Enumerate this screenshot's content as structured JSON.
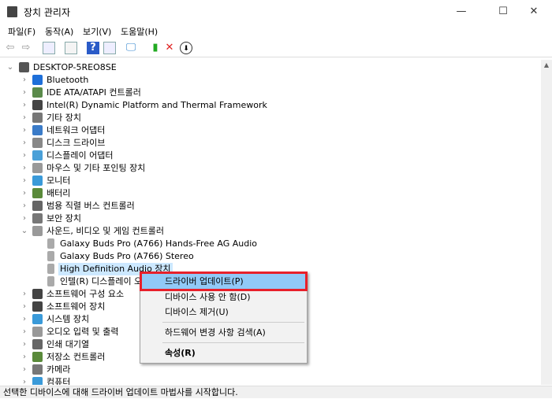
{
  "window": {
    "title": "장치 관리자",
    "minimize": "—",
    "maximize": "☐",
    "close": "✕"
  },
  "menu": [
    "파일(F)",
    "동작(A)",
    "보기(V)",
    "도움말(H)"
  ],
  "toolbar": [
    "back-icon",
    "forward-icon",
    "show-hide-console-tree-icon",
    "properties-icon",
    "help-icon",
    "action-pane-icon",
    "scan-hardware-icon",
    "update-driver-icon",
    "uninstall-icon",
    "disable-icon"
  ],
  "tree": {
    "root": "DESKTOP-5REO8SE",
    "items": [
      {
        "label": "Bluetooth",
        "color": "#1e6fd9"
      },
      {
        "label": "IDE ATA/ATAPI 컨트롤러",
        "color": "#5a8a4a"
      },
      {
        "label": "Intel(R) Dynamic Platform and Thermal Framework",
        "color": "#444"
      },
      {
        "label": "기타 장치",
        "color": "#777"
      },
      {
        "label": "네트워크 어댑터",
        "color": "#3a7bc8"
      },
      {
        "label": "디스크 드라이브",
        "color": "#888"
      },
      {
        "label": "디스플레이 어댑터",
        "color": "#4aa0d8"
      },
      {
        "label": "마우스 및 기타 포인팅 장치",
        "color": "#999"
      },
      {
        "label": "모니터",
        "color": "#3a9ad9"
      },
      {
        "label": "배터리",
        "color": "#5a8a3a"
      },
      {
        "label": "범용 직렬 버스 컨트롤러",
        "color": "#666"
      },
      {
        "label": "보안 장치",
        "color": "#777"
      },
      {
        "label": "사운드, 비디오 및 게임 컨트롤러",
        "color": "#999",
        "expanded": true,
        "children": [
          "Galaxy Buds Pro (A766) Hands-Free AG Audio",
          "Galaxy Buds Pro (A766) Stereo",
          "High Definition Audio 장치",
          "인텔(R) 디스플레이 오디오"
        ]
      },
      {
        "label": "소프트웨어 구성 요소",
        "color": "#444"
      },
      {
        "label": "소프트웨어 장치",
        "color": "#444"
      },
      {
        "label": "시스템 장치",
        "color": "#3a9ad9"
      },
      {
        "label": "오디오 입력 및 출력",
        "color": "#999"
      },
      {
        "label": "인쇄 대기열",
        "color": "#666"
      },
      {
        "label": "저장소 컨트롤러",
        "color": "#5a8a3a"
      },
      {
        "label": "카메라",
        "color": "#777"
      },
      {
        "label": "컴퓨터",
        "color": "#3a9ad9"
      }
    ]
  },
  "context_menu": {
    "items": [
      "드라이버 업데이트(P)",
      "디바이스 사용 안 함(D)",
      "디바이스 제거(U)",
      "하드웨어 변경 사항 검색(A)",
      "속성(R)"
    ],
    "highlight": "#91c9f7",
    "annotation_color": "#e8202a"
  },
  "status": "선택한 디바이스에 대해 드라이버 업데이트 마법사를 시작합니다."
}
